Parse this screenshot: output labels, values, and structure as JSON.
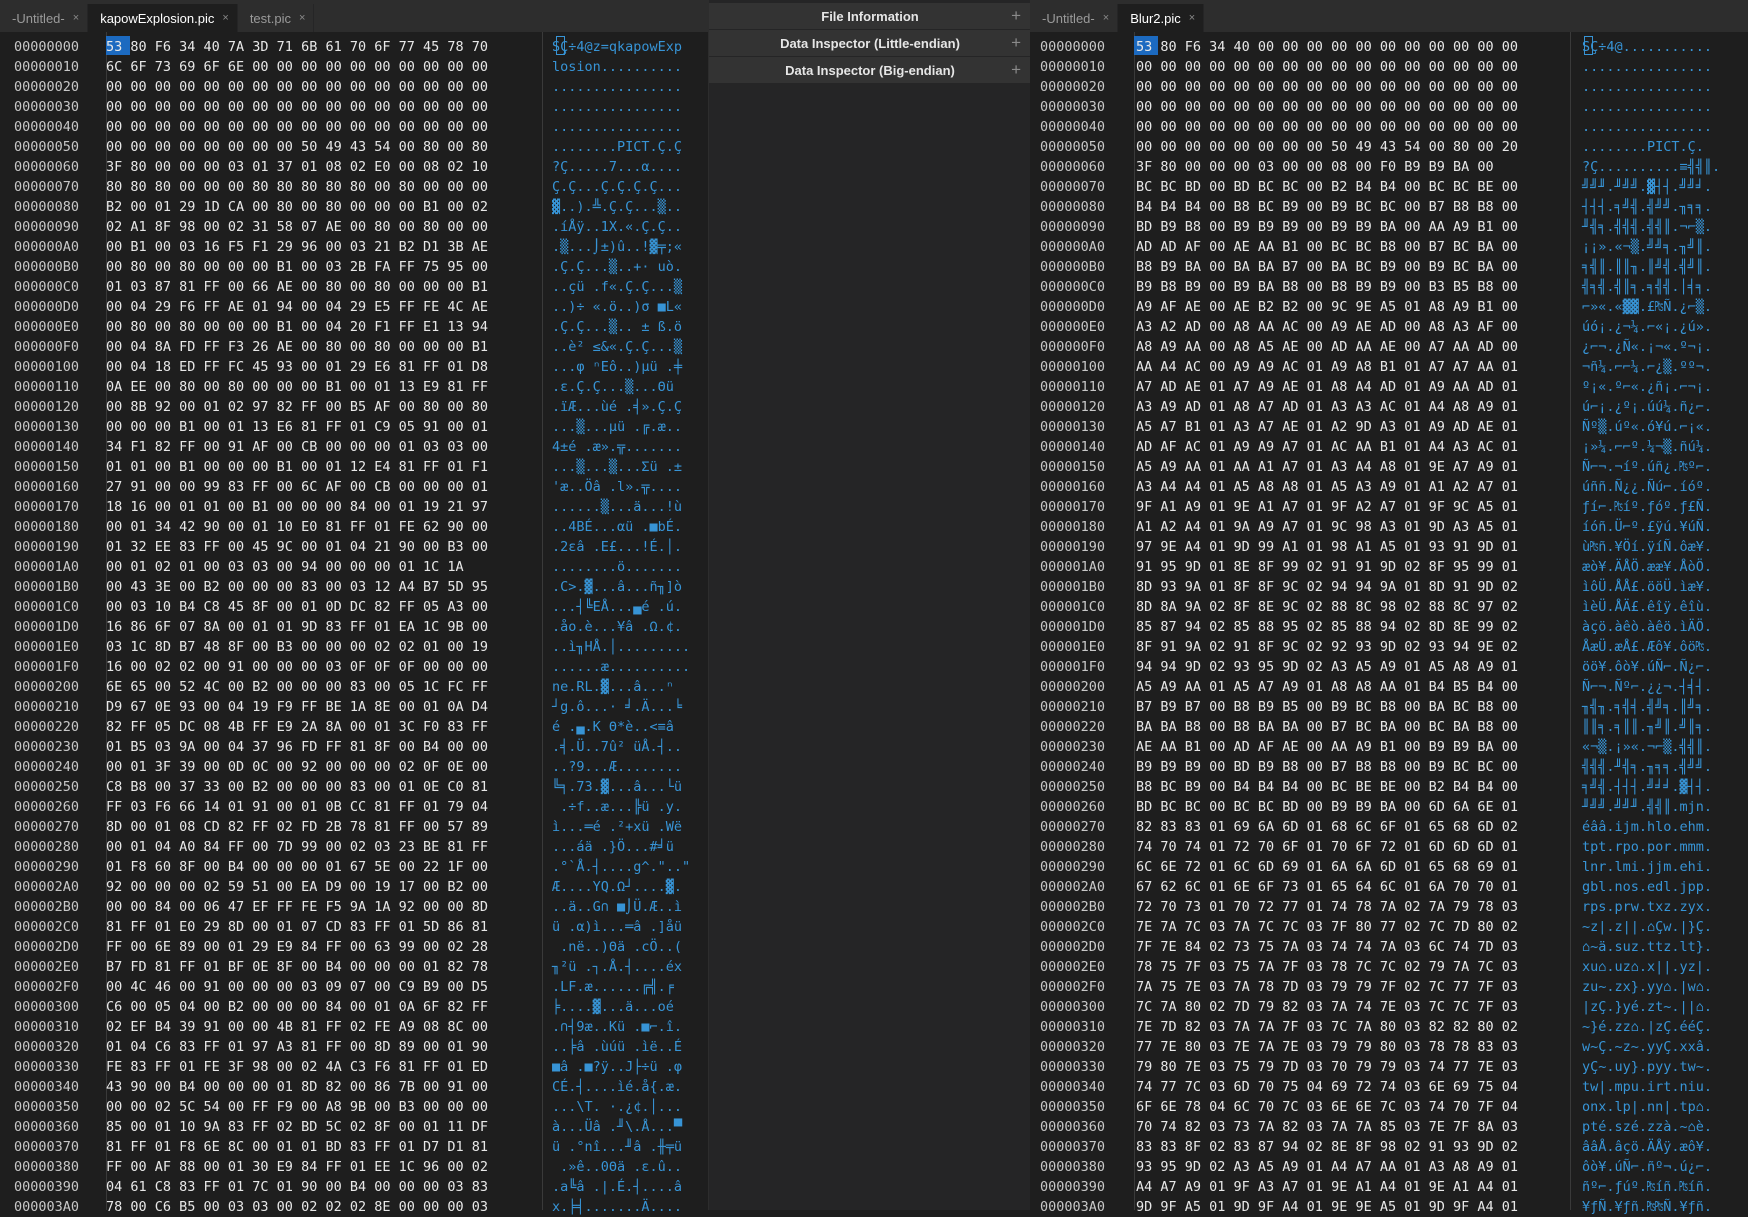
{
  "left": {
    "tabs": [
      {
        "label": "-Untitled-",
        "close": "×",
        "active": false
      },
      {
        "label": "kapowExplosion.pic",
        "close": "×",
        "active": true
      },
      {
        "label": "test.pic",
        "close": "×",
        "active": false
      }
    ],
    "cursor": {
      "byte": "53",
      "char": "S"
    },
    "rows": [
      {
        "addr": "00000000",
        "hex": "53 80 F6 34 40 7A 3D 71 6B 61 70 6F 77 45 78 70",
        "ascii": "SÇ÷4@z=qkapowExp"
      },
      {
        "addr": "00000010",
        "hex": "6C 6F 73 69 6F 6E 00 00 00 00 00 00 00 00 00 00",
        "ascii": "losion.........."
      },
      {
        "addr": "00000020",
        "hex": "00 00 00 00 00 00 00 00 00 00 00 00 00 00 00 00",
        "ascii": "................"
      },
      {
        "addr": "00000030",
        "hex": "00 00 00 00 00 00 00 00 00 00 00 00 00 00 00 00",
        "ascii": "................"
      },
      {
        "addr": "00000040",
        "hex": "00 00 00 00 00 00 00 00 00 00 00 00 00 00 00 00",
        "ascii": "................"
      },
      {
        "addr": "00000050",
        "hex": "00 00 00 00 00 00 00 00 50 49 43 54 00 80 00 80",
        "ascii": "........PICT.Ç.Ç"
      },
      {
        "addr": "00000060",
        "hex": "3F 80 00 00 00 03 01 37 01 08 02 E0 00 08 02 10",
        "ascii": "?Ç.....7...α...."
      },
      {
        "addr": "00000070",
        "hex": "80 80 80 00 00 00 80 80 80 80 80 00 80 00 00 00",
        "ascii": "Ç.Ç...Ç.Ç.Ç.Ç..."
      },
      {
        "addr": "00000080",
        "hex": "B2 00 01 29 1D CA 00 80 00 80 00 00 00 B1 00 02",
        "ascii": "▓..).╩.Ç.Ç...▒.."
      },
      {
        "addr": "00000090",
        "hex": "02 A1 8F 98 00 02 31 58 07 AE 00 80 00 80 00 00",
        "ascii": ".íÅÿ..1X.«.Ç.Ç.."
      },
      {
        "addr": "000000A0",
        "hex": "00 B1 00 03 16 F5 F1 29 96 00 03 21 B2 D1 3B AE",
        "ascii": ".▒...⌡±)û..!▓╤;«"
      },
      {
        "addr": "000000B0",
        "hex": "00 80 00 80 00 00 00 B1 00 03 2B FA FF 75 95 00",
        "ascii": ".Ç.Ç...▒..+· uò."
      },
      {
        "addr": "000000C0",
        "hex": "01 03 87 81 FF 00 66 AE 00 80 00 80 00 00 00 B1",
        "ascii": "..çü .f«.Ç.Ç...▒"
      },
      {
        "addr": "000000D0",
        "hex": "00 04 29 F6 FF AE 01 94 00 04 29 E5 FF FE 4C AE",
        "ascii": "..)÷ «.ö..)σ ■L«"
      },
      {
        "addr": "000000E0",
        "hex": "00 80 00 80 00 00 00 B1 00 04 20 F1 FF E1 13 94",
        "ascii": ".Ç.Ç...▒.. ± ß.ö"
      },
      {
        "addr": "000000F0",
        "hex": "00 04 8A FD FF F3 26 AE 00 80 00 80 00 00 00 B1",
        "ascii": "..è² ≤&«.Ç.Ç...▒"
      },
      {
        "addr": "00000100",
        "hex": "00 04 18 ED FF FC 45 93 00 01 29 E6 81 FF 01 D8",
        "ascii": "...φ ⁿEô..)µü .╪"
      },
      {
        "addr": "00000110",
        "hex": "0A EE 00 80 00 80 00 00 00 B1 00 01 13 E9 81 FF",
        "ascii": ".ε.Ç.Ç...▒...Θü "
      },
      {
        "addr": "00000120",
        "hex": "00 8B 92 00 01 02 97 82 FF 00 B5 AF 00 80 00 80",
        "ascii": ".ïÆ...ùé .╡».Ç.Ç"
      },
      {
        "addr": "00000130",
        "hex": "00 00 00 B1 00 01 13 E6 81 FF 01 C9 05 91 00 01",
        "ascii": "...▒...µü .╔.æ.."
      },
      {
        "addr": "00000140",
        "hex": "34 F1 82 FF 00 91 AF 00 CB 00 00 00 01 03 03 00",
        "ascii": "4±é .æ».╦......."
      },
      {
        "addr": "00000150",
        "hex": "01 01 00 B1 00 00 00 B1 00 01 12 E4 81 FF 01 F1",
        "ascii": "...▒...▒...Σü .±"
      },
      {
        "addr": "00000160",
        "hex": "27 91 00 00 99 83 FF 00 6C AF 00 CB 00 00 00 01",
        "ascii": "'æ..Öâ .l».╦...."
      },
      {
        "addr": "00000170",
        "hex": "18 16 00 01 01 00 B1 00 00 00 84 00 01 19 21 97",
        "ascii": "......▒...ä...!ù"
      },
      {
        "addr": "00000180",
        "hex": "00 01 34 42 90 00 01 10 E0 81 FF 01 FE 62 90 00",
        "ascii": "..4BÉ...αü .■bÉ."
      },
      {
        "addr": "00000190",
        "hex": "01 32 EE 83 FF 00 45 9C 00 01 04 21 90 00 B3 00",
        "ascii": ".2εâ .E£...!É.│."
      },
      {
        "addr": "000001A0",
        "hex": "00 01 02 01 00 03 03 00 94 00 00 00 01 1C 1A",
        "ascii": "........ö......."
      },
      {
        "addr": "000001B0",
        "hex": "00 43 3E 00 B2 00 00 00 83 00 03 12 A4 B7 5D 95",
        "ascii": ".C>.▓...â...ñ╖]ò"
      },
      {
        "addr": "000001C0",
        "hex": "00 03 10 B4 C8 45 8F 00 01 0D DC 82 FF 05 A3 00",
        "ascii": "...┤╚EÅ...▄é .ú."
      },
      {
        "addr": "000001D0",
        "hex": "16 86 6F 07 8A 00 01 01 9D 83 FF 01 EA 1C 9B 00",
        "ascii": ".åo.è...¥â .Ω.¢."
      },
      {
        "addr": "000001E0",
        "hex": "03 1C 8D B7 48 8F 00 B3 00 00 00 02 02 01 00 19",
        "ascii": "..ì╖HÅ.│........."
      },
      {
        "addr": "000001F0",
        "hex": "16 00 02 02 00 91 00 00 00 03 0F 0F 0F 00 00 00",
        "ascii": "......æ.........."
      },
      {
        "addr": "00000200",
        "hex": "6E 65 00 52 4C 00 B2 00 00 00 83 00 05 1C FC FF",
        "ascii": "ne.RL.▓...â...ⁿ "
      },
      {
        "addr": "00000210",
        "hex": "D9 67 0E 93 00 04 19 F9 FF BE 1A 8E 00 01 0A D4",
        "ascii": "┘g.ô...· ╛.Ä...╘"
      },
      {
        "addr": "00000220",
        "hex": "82 FF 05 DC 08 4B FF E9 2A 8A 00 01 3C F0 83 FF",
        "ascii": "é .▄.K Θ*è..<≡â "
      },
      {
        "addr": "00000230",
        "hex": "01 B5 03 9A 00 04 37 96 FD FF 81 8F 00 B4 00 00",
        "ascii": ".╡.Ü..7û² üÅ.┤.."
      },
      {
        "addr": "00000240",
        "hex": "00 01 3F 39 00 0D 0C 00 92 00 00 00 02 0F 0E 00",
        "ascii": "..?9...Æ........"
      },
      {
        "addr": "00000250",
        "hex": "C8 B8 00 37 33 00 B2 00 00 00 83 00 01 0E C0 81",
        "ascii": "╚╕.73.▓...â...└ü"
      },
      {
        "addr": "00000260",
        "hex": "FF 03 F6 66 14 01 91 00 01 0B CC 81 FF 01 79 04",
        "ascii": " .÷f..æ...╠ü .y."
      },
      {
        "addr": "00000270",
        "hex": "8D 00 01 08 CD 82 FF 02 FD 2B 78 81 FF 00 57 89",
        "ascii": "ì...═é .²+xü .Wë"
      },
      {
        "addr": "00000280",
        "hex": "00 01 04 A0 84 FF 00 7D 99 00 02 03 23 BE 81 FF",
        "ascii": "...áä .}Ö...#╛ü "
      },
      {
        "addr": "00000290",
        "hex": "01 F8 60 8F 00 B4 00 00 00 01 67 5E 00 22 1F 00",
        "ascii": ".°`Å.┤....g^.\"..\""
      },
      {
        "addr": "000002A0",
        "hex": "92 00 00 00 02 59 51 00 EA D9 00 19 17 00 B2 00",
        "ascii": "Æ....YQ.Ω┘....▓."
      },
      {
        "addr": "000002B0",
        "hex": "00 00 84 00 06 47 EF FF FE F5 9A 1A 92 00 00 8D",
        "ascii": "..ä..G∩ ■⌡Ü.Æ..ì"
      },
      {
        "addr": "000002C0",
        "hex": "81 FF 01 E0 29 8D 00 01 07 CD 83 FF 01 5D 86 81",
        "ascii": "ü .α)ì...═â .]åü"
      },
      {
        "addr": "000002D0",
        "hex": "FF 00 6E 89 00 01 29 E9 84 FF 00 63 99 00 02 28",
        "ascii": " .në..)Θä .cÖ..("
      },
      {
        "addr": "000002E0",
        "hex": "B7 FD 81 FF 01 BF 0E 8F 00 B4 00 00 00 01 82 78",
        "ascii": "╖²ü .┐.Å.┤....éx"
      },
      {
        "addr": "000002F0",
        "hex": "00 4C 46 00 91 00 00 00 03 09 07 00 C9 B9 00 D5",
        "ascii": ".LF.æ......╔╣.╒"
      },
      {
        "addr": "00000300",
        "hex": "C6 00 05 04 00 B2 00 00 00 84 00 01 0A 6F 82 FF",
        "ascii": "╞....▓...ä...oé "
      },
      {
        "addr": "00000310",
        "hex": "02 EF B4 39 91 00 00 4B 81 FF 02 FE A9 08 8C 00",
        "ascii": ".∩┤9æ..Kü .■⌐.î."
      },
      {
        "addr": "00000320",
        "hex": "01 04 C6 83 FF 01 97 A3 81 FF 00 8D 89 00 01 90",
        "ascii": "..╞â .ùúü .ìë..É"
      },
      {
        "addr": "00000330",
        "hex": "FE 83 FF 01 FE 3F 98 00 02 4A C3 F6 81 FF 01 ED",
        "ascii": "■â .■?ÿ..J├÷ü .φ"
      },
      {
        "addr": "00000340",
        "hex": "43 90 00 B4 00 00 00 01 8D 82 00 86 7B 00 91 00",
        "ascii": "CÉ.┤....ìé.å{.æ."
      },
      {
        "addr": "00000350",
        "hex": "00 00 02 5C 54 00 FF F9 00 A8 9B 00 B3 00 00 00",
        "ascii": "...\\T. ·.¿¢.│..."
      },
      {
        "addr": "00000360",
        "hex": "85 00 01 10 9A 83 FF 02 BD 5C 02 8F 00 01 11 DF",
        "ascii": "à...Üâ .╜\\.Å...▀"
      },
      {
        "addr": "00000370",
        "hex": "81 FF 01 F8 6E 8C 00 01 01 BD 83 FF 01 D7 D1 81",
        "ascii": "ü .°nî...╜â .╫╤ü"
      },
      {
        "addr": "00000380",
        "hex": "FF 00 AF 88 00 01 30 E9 84 FF 01 EE 1C 96 00 02",
        "ascii": " .»ê..0Θä .ε.û.."
      },
      {
        "addr": "00000390",
        "hex": "04 61 C8 83 FF 01 7C 01 90 00 B4 00 00 00 03 83",
        "ascii": ".a╚â .|.É.┤....â"
      },
      {
        "addr": "000003A0",
        "hex": "78 00 C6 B5 00 03 03 00 02 02 02 8E 00 00 00 03",
        "ascii": "x.╞╡.......Ä...."
      }
    ]
  },
  "middle": {
    "sections": [
      {
        "label": "File Information",
        "icon": "+"
      },
      {
        "label": "Data Inspector (Little-endian)",
        "icon": "+"
      },
      {
        "label": "Data Inspector (Big-endian)",
        "icon": "+"
      }
    ]
  },
  "right": {
    "tabs": [
      {
        "label": "-Untitled-",
        "close": "×",
        "active": false
      },
      {
        "label": "Blur2.pic",
        "close": "×",
        "active": true
      }
    ],
    "cursor": {
      "byte": "53",
      "char": "S"
    },
    "rows": [
      {
        "addr": "00000000",
        "hex": "53 80 F6 34 40 00 00 00 00 00 00 00 00 00 00 00",
        "ascii": "SÇ÷4@..........."
      },
      {
        "addr": "00000010",
        "hex": "00 00 00 00 00 00 00 00 00 00 00 00 00 00 00 00",
        "ascii": "................"
      },
      {
        "addr": "00000020",
        "hex": "00 00 00 00 00 00 00 00 00 00 00 00 00 00 00 00",
        "ascii": "................"
      },
      {
        "addr": "00000030",
        "hex": "00 00 00 00 00 00 00 00 00 00 00 00 00 00 00 00",
        "ascii": "................"
      },
      {
        "addr": "00000040",
        "hex": "00 00 00 00 00 00 00 00 00 00 00 00 00 00 00 00",
        "ascii": "................"
      },
      {
        "addr": "00000050",
        "hex": "00 00 00 00 00 00 00 00 50 49 43 54 00 80 00 20",
        "ascii": "........PICT.Ç. "
      },
      {
        "addr": "00000060",
        "hex": "3F 80 00 00 00 03 00 00 08 00 F0 B9 B9 BA 00",
        "ascii": "?Ç..........≡╣╣║."
      },
      {
        "addr": "00000070",
        "hex": "BC BC BD 00 BD BC BC 00 B2 B4 B4 00 BC BC BE 00",
        "ascii": "╝╝╜.╜╝╝.▓┤┤.╝╝╛."
      },
      {
        "addr": "00000080",
        "hex": "B4 B4 B4 00 B8 BC B9 00 B9 BC BC 00 B7 B8 B8 00",
        "ascii": "┤┤┤.╕╝╣.╣╝╝.╖╕╕."
      },
      {
        "addr": "00000090",
        "hex": "BD B9 B8 00 B9 B9 B9 00 B9 B9 BA 00 AA A9 B1 00",
        "ascii": "╜╣╕.╣╣╣.╣╣║.¬⌐▒."
      },
      {
        "addr": "000000A0",
        "hex": "AD AD AF 00 AE AA B1 00 BC BC B8 00 B7 BC BA 00",
        "ascii": "¡¡».«¬▒.╝╝╕.╖╝║."
      },
      {
        "addr": "000000B0",
        "hex": "B8 B9 BA 00 BA BA B7 00 BA BC B9 00 B9 BC BA 00",
        "ascii": "╕╣║.║║╖.║╝╣.╣╝║."
      },
      {
        "addr": "000000C0",
        "hex": "B9 B8 B9 00 B9 BA B8 00 B8 B9 B9 00 B3 B5 B8 00",
        "ascii": "╣╕╣.╣║╕.╕╣╣.│╡╕."
      },
      {
        "addr": "000000D0",
        "hex": "A9 AF AE 00 AE B2 B2 00 9C 9E A5 01 A8 A9 B1 00",
        "ascii": "⌐»«.«▓▓.£₧Ñ.¿⌐▒."
      },
      {
        "addr": "000000E0",
        "hex": "A3 A2 AD 00 A8 AA AC 00 A9 AE AD 00 A8 A3 AF 00",
        "ascii": "úó¡.¿¬¼.⌐«¡.¿ú»."
      },
      {
        "addr": "000000F0",
        "hex": "A8 A9 AA 00 A8 A5 AE 00 AD AA AE 00 A7 AA AD 00",
        "ascii": "¿⌐¬.¿Ñ«.¡¬«.º¬¡."
      },
      {
        "addr": "00000100",
        "hex": "AA A4 AC 00 A9 A9 AC 01 A9 A8 B1 01 A7 A7 AA 01",
        "ascii": "¬ñ¼.⌐⌐¼.⌐¿▒.ºº¬."
      },
      {
        "addr": "00000110",
        "hex": "A7 AD AE 01 A7 A9 AE 01 A8 A4 AD 01 A9 AA AD 01",
        "ascii": "º¡«.º⌐«.¿ñ¡.⌐¬¡."
      },
      {
        "addr": "00000120",
        "hex": "A3 A9 AD 01 A8 A7 AD 01 A3 A3 AC 01 A4 A8 A9 01",
        "ascii": "ú⌐¡.¿º¡.úú¼.ñ¿⌐."
      },
      {
        "addr": "00000130",
        "hex": "A5 A7 B1 01 A3 A7 AE 01 A2 9D A3 01 A9 AD AE 01",
        "ascii": "Ñº▒.úº«.ó¥ú.⌐¡«."
      },
      {
        "addr": "00000140",
        "hex": "AD AF AC 01 A9 A9 A7 01 AC AA B1 01 A4 A3 AC 01",
        "ascii": "¡»¼.⌐⌐º.¼¬▒.ñú¼."
      },
      {
        "addr": "00000150",
        "hex": "A5 A9 AA 01 AA A1 A7 01 A3 A4 A8 01 9E A7 A9 01",
        "ascii": "Ñ⌐¬.¬íº.úñ¿.₧º⌐."
      },
      {
        "addr": "00000160",
        "hex": "A3 A4 A4 01 A5 A8 A8 01 A5 A3 A9 01 A1 A2 A7 01",
        "ascii": "úññ.Ñ¿¿.Ñú⌐.íóº."
      },
      {
        "addr": "00000170",
        "hex": "9F A1 A9 01 9E A1 A7 01 9F A2 A7 01 9F 9C A5 01",
        "ascii": "ƒí⌐.₧íº.ƒóº.ƒ£Ñ."
      },
      {
        "addr": "00000180",
        "hex": "A1 A2 A4 01 9A A9 A7 01 9C 98 A3 01 9D A3 A5 01",
        "ascii": "íóñ.Ü⌐º.£ÿú.¥úÑ."
      },
      {
        "addr": "00000190",
        "hex": "97 9E A4 01 9D 99 A1 01 98 A1 A5 01 93 91 9D 01",
        "ascii": "ù₧ñ.¥Öí.ÿíÑ.ôæ¥."
      },
      {
        "addr": "000001A0",
        "hex": "91 95 9D 01 8E 8F 99 02 91 91 9D 02 8F 95 99 01",
        "ascii": "æò¥.ÄÅÖ.ææ¥.ÅòÖ."
      },
      {
        "addr": "000001B0",
        "hex": "8D 93 9A 01 8F 8F 9C 02 94 94 9A 01 8D 91 9D 02",
        "ascii": "ìôÜ.ÅÅ£.ööÜ.ìæ¥."
      },
      {
        "addr": "000001C0",
        "hex": "8D 8A 9A 02 8F 8E 9C 02 88 8C 98 02 88 8C 97 02",
        "ascii": "ìèÜ.ÅÄ£.êîÿ.êîù."
      },
      {
        "addr": "000001D0",
        "hex": "85 87 94 02 85 88 95 02 85 88 94 02 8D 8E 99 02",
        "ascii": "àçö.àêò.àêö.ìÄÖ."
      },
      {
        "addr": "000001E0",
        "hex": "8F 91 9A 02 91 8F 9C 02 92 93 9D 02 93 94 9E 02",
        "ascii": "ÅæÜ.æÅ£.Æô¥.ôö₧."
      },
      {
        "addr": "000001F0",
        "hex": "94 94 9D 02 93 95 9D 02 A3 A5 A9 01 A5 A8 A9 01",
        "ascii": "öö¥.ôò¥.úÑ⌐.Ñ¿⌐."
      },
      {
        "addr": "00000200",
        "hex": "A5 A9 AA 01 A5 A7 A9 01 A8 A8 AA 01 B4 B5 B4 00",
        "ascii": "Ñ⌐¬.Ñº⌐.¿¿¬.┤╡┤."
      },
      {
        "addr": "00000210",
        "hex": "B7 B9 B7 00 B8 B9 B5 00 B9 BC B8 00 BA BC B8 00",
        "ascii": "╖╣╖.╕╣╡.╣╝╕.║╝╕."
      },
      {
        "addr": "00000220",
        "hex": "BA BA B8 00 B8 BA BA 00 B7 BC BA 00 BC BA B8 00",
        "ascii": "║║╕.╕║║.╖╝║.╝║╕."
      },
      {
        "addr": "00000230",
        "hex": "AE AA B1 00 AD AF AE 00 AA A9 B1 00 B9 B9 BA 00",
        "ascii": "«¬▒.¡»«.¬⌐▒.╣╣║."
      },
      {
        "addr": "00000240",
        "hex": "B9 B9 B9 00 BD B9 B8 00 B7 B8 B8 00 B9 BC BC 00",
        "ascii": "╣╣╣.╜╣╕.╖╕╕.╣╝╝."
      },
      {
        "addr": "00000250",
        "hex": "B8 BC B9 00 B4 B4 B4 00 BC BE BE 00 B2 B4 B4 00",
        "ascii": "╕╝╣.┤┤┤.╝╛╛.▓┤┤."
      },
      {
        "addr": "00000260",
        "hex": "BD BC BC 00 BC BC BD 00 B9 B9 BA 00 6D 6A 6E 01",
        "ascii": "╜╝╝.╝╝╜.╣╣║.mjn."
      },
      {
        "addr": "00000270",
        "hex": "82 83 83 01 69 6A 6D 01 68 6C 6F 01 65 68 6D 02",
        "ascii": "éââ.ijm.hlo.ehm."
      },
      {
        "addr": "00000280",
        "hex": "74 70 74 01 72 70 6F 01 70 6F 72 01 6D 6D 6D 01",
        "ascii": "tpt.rpo.por.mmm."
      },
      {
        "addr": "00000290",
        "hex": "6C 6E 72 01 6C 6D 69 01 6A 6A 6D 01 65 68 69 01",
        "ascii": "lnr.lmi.jjm.ehi."
      },
      {
        "addr": "000002A0",
        "hex": "67 62 6C 01 6E 6F 73 01 65 64 6C 01 6A 70 70 01",
        "ascii": "gbl.nos.edl.jpp."
      },
      {
        "addr": "000002B0",
        "hex": "72 70 73 01 70 72 77 01 74 78 7A 02 7A 79 78 03",
        "ascii": "rps.prw.txz.zyx."
      },
      {
        "addr": "000002C0",
        "hex": "7E 7A 7C 03 7A 7C 7C 03 7F 80 77 02 7C 7D 80 02",
        "ascii": "~z|.z||.⌂Çw.|}Ç."
      },
      {
        "addr": "000002D0",
        "hex": "7F 7E 84 02 73 75 7A 03 74 74 7A 03 6C 74 7D 03",
        "ascii": "⌂~ä.suz.ttz.lt}."
      },
      {
        "addr": "000002E0",
        "hex": "78 75 7F 03 75 7A 7F 03 78 7C 7C 02 79 7A 7C 03",
        "ascii": "xu⌂.uz⌂.x||.yz|."
      },
      {
        "addr": "000002F0",
        "hex": "7A 75 7E 03 7A 78 7D 03 79 79 7F 02 7C 77 7F 03",
        "ascii": "zu~.zx}.yy⌂.|w⌂."
      },
      {
        "addr": "00000300",
        "hex": "7C 7A 80 02 7D 79 82 03 7A 74 7E 03 7C 7C 7F 03",
        "ascii": "|zÇ.}yé.zt~.||⌂."
      },
      {
        "addr": "00000310",
        "hex": "7E 7D 82 03 7A 7A 7F 03 7C 7A 80 03 82 82 80 02",
        "ascii": "~}é.zz⌂.|zÇ.ééÇ."
      },
      {
        "addr": "00000320",
        "hex": "77 7E 80 03 7E 7A 7E 03 79 79 80 03 78 78 83 03",
        "ascii": "w~Ç.~z~.yyÇ.xxâ."
      },
      {
        "addr": "00000330",
        "hex": "79 80 7E 03 75 79 7D 03 70 79 79 03 74 77 7E 03",
        "ascii": "yÇ~.uy}.pyy.tw~."
      },
      {
        "addr": "00000340",
        "hex": "74 77 7C 03 6D 70 75 04 69 72 74 03 6E 69 75 04",
        "ascii": "tw|.mpu.irt.niu."
      },
      {
        "addr": "00000350",
        "hex": "6F 6E 78 04 6C 70 7C 03 6E 6E 7C 03 74 70 7F 04",
        "ascii": "onx.lp|.nn|.tp⌂."
      },
      {
        "addr": "00000360",
        "hex": "70 74 82 03 73 7A 82 03 7A 7A 85 03 7E 7F 8A 03",
        "ascii": "pté.szé.zzà.~⌂è."
      },
      {
        "addr": "00000370",
        "hex": "83 83 8F 02 83 87 94 02 8E 8F 98 02 91 93 9D 02",
        "ascii": "ââÅ.âçö.ÄÅÿ.æô¥."
      },
      {
        "addr": "00000380",
        "hex": "93 95 9D 02 A3 A5 A9 01 A4 A7 AA 01 A3 A8 A9 01",
        "ascii": "ôò¥.úÑ⌐.ñº¬.ú¿⌐."
      },
      {
        "addr": "00000390",
        "hex": "A4 A7 A9 01 9F A3 A7 01 9E A1 A4 01 9E A1 A4 01",
        "ascii": "ñº⌐.ƒúº.₧íñ.₧íñ."
      },
      {
        "addr": "000003A0",
        "hex": "9D 9F A5 01 9D 9F A4 01 9E 9E A5 01 9D 9F A4 01",
        "ascii": "¥ƒÑ.¥ƒñ.₧₧Ñ.¥ƒñ."
      }
    ]
  }
}
